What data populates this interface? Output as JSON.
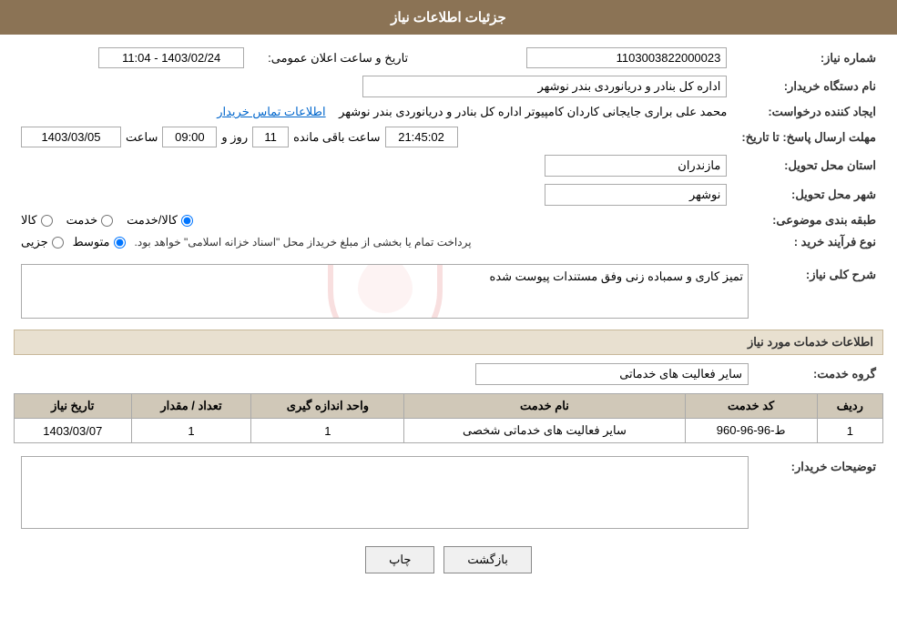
{
  "header": {
    "title": "جزئیات اطلاعات نیاز"
  },
  "fields": {
    "need_number_label": "شماره نیاز:",
    "need_number_value": "1103003822000023",
    "buyer_name_label": "نام دستگاه خریدار:",
    "buyer_name_value": "اداره کل بنادر و دریانوردی بندر نوشهر",
    "creator_label": "ایجاد کننده درخواست:",
    "creator_value": "محمد علی براری جایجانی کاردان کامپیوتر اداره کل بنادر و دریانوردی بندر نوشهر",
    "creator_link": "اطلاعات تماس خریدار",
    "send_deadline_label": "مهلت ارسال پاسخ: تا تاریخ:",
    "send_date": "1403/03/05",
    "send_time_label": "ساعت",
    "send_time": "09:00",
    "send_days_label": "روز و",
    "send_days": "11",
    "send_remaining_label": "ساعت باقی مانده",
    "send_remaining": "21:45:02",
    "province_label": "استان محل تحویل:",
    "province_value": "مازندران",
    "city_label": "شهر محل تحویل:",
    "city_value": "نوشهر",
    "category_label": "طبقه بندی موضوعی:",
    "radio_kala": "کالا",
    "radio_khedmat": "خدمت",
    "radio_kala_khedmat": "کالا/خدمت",
    "purchase_type_label": "نوع فرآیند خرید :",
    "radio_jozvi": "جزیی",
    "radio_motovaset": "متوسط",
    "purchase_note": "پرداخت تمام یا بخشی از مبلغ خریداز محل \"اسناد خزانه اسلامی\" خواهد بود.",
    "description_label": "شرح کلی نیاز:",
    "description_value": "تمیز کاری و سمباده زنی وفق مستندات پیوست شده",
    "services_section_title": "اطلاعات خدمات مورد نیاز",
    "service_group_label": "گروه خدمت:",
    "service_group_value": "سایر فعالیت های خدماتی",
    "table": {
      "col_row_num": "ردیف",
      "col_service_code": "کد خدمت",
      "col_service_name": "نام خدمت",
      "col_unit": "واحد اندازه گیری",
      "col_quantity": "تعداد / مقدار",
      "col_date": "تاریخ نیاز",
      "rows": [
        {
          "row_num": "1",
          "service_code": "ط-96-96-960",
          "service_name": "سایر فعالیت های خدماتی شخصی",
          "unit": "1",
          "quantity": "1",
          "date": "1403/03/07"
        }
      ]
    },
    "buyer_notes_label": "توضیحات خریدار:",
    "buyer_notes_value": "",
    "btn_print": "چاپ",
    "btn_back": "بازگشت",
    "announce_date_label": "تاریخ و ساعت اعلان عمومی:",
    "announce_date_value": "1403/02/24 - 11:04"
  }
}
